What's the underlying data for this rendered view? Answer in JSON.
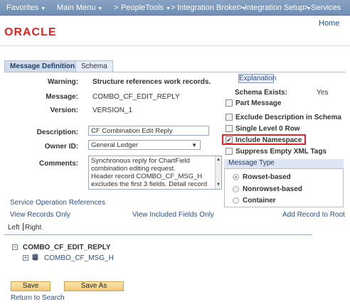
{
  "nav": {
    "favorites": "Favorites",
    "main_menu": "Main Menu",
    "peopletools": "PeopleTools",
    "integration_broker": "Integration Broker",
    "integration_setup": "Integration Setup",
    "services": "Services",
    "home": "Home",
    "chevron": "▼",
    "sep": ">"
  },
  "logo": {
    "text": "ORACLE",
    "color": "#e2231a"
  },
  "tabs": [
    {
      "label": "Message Definition"
    },
    {
      "label": "Schema"
    }
  ],
  "form": {
    "warning_label": "Warning:",
    "warning_value": "Structure references work records.",
    "message_label": "Message:",
    "message_value": "COMBO_CF_EDIT_REPLY",
    "version_label": "Version:",
    "version_value": "VERSION_1",
    "description_label": "Description:",
    "description_value": "CF Combination Edit Reply",
    "owner_label": "Owner ID:",
    "owner_value": "General Ledger",
    "comments_label": "Comments:",
    "comments_lines": [
      "Synchronous reply for ChartField",
      "combination editing request.",
      "Header record COMBO_CF_MSG_H",
      "excludes the first 3 fields.  Detail record"
    ]
  },
  "right": {
    "explanation": "Explanation",
    "schema_exists_label": "Schema Exists:",
    "schema_exists_value": "Yes",
    "checkboxes": [
      {
        "label": "Part Message",
        "checked": false
      },
      {
        "label": "Exclude Description in Schema",
        "checked": false
      },
      {
        "label": "Single Level 0 Row",
        "checked": false
      },
      {
        "label": "Include Namespace",
        "checked": true
      },
      {
        "label": "Suppress Empty XML Tags",
        "checked": false
      }
    ],
    "message_type_title": "Message Type",
    "message_types": [
      {
        "label": "Rowset-based",
        "selected": true
      },
      {
        "label": "Nonrowset-based",
        "selected": false
      },
      {
        "label": "Container",
        "selected": false
      }
    ]
  },
  "links": {
    "service_op_refs": "Service Operation References",
    "view_records_only": "View Records Only",
    "view_included_fields": "View Included Fields Only",
    "add_record_to_root": "Add Record to Root",
    "left": "Left",
    "right": "Right"
  },
  "tree": {
    "root": "COMBO_CF_EDIT_REPLY",
    "child": "COMBO_CF_MSG_H",
    "collapse_glyph": "−",
    "expand_glyph": "+"
  },
  "buttons": {
    "save": "Save",
    "save_as": "Save As",
    "return_to_search": "Return to Search"
  }
}
